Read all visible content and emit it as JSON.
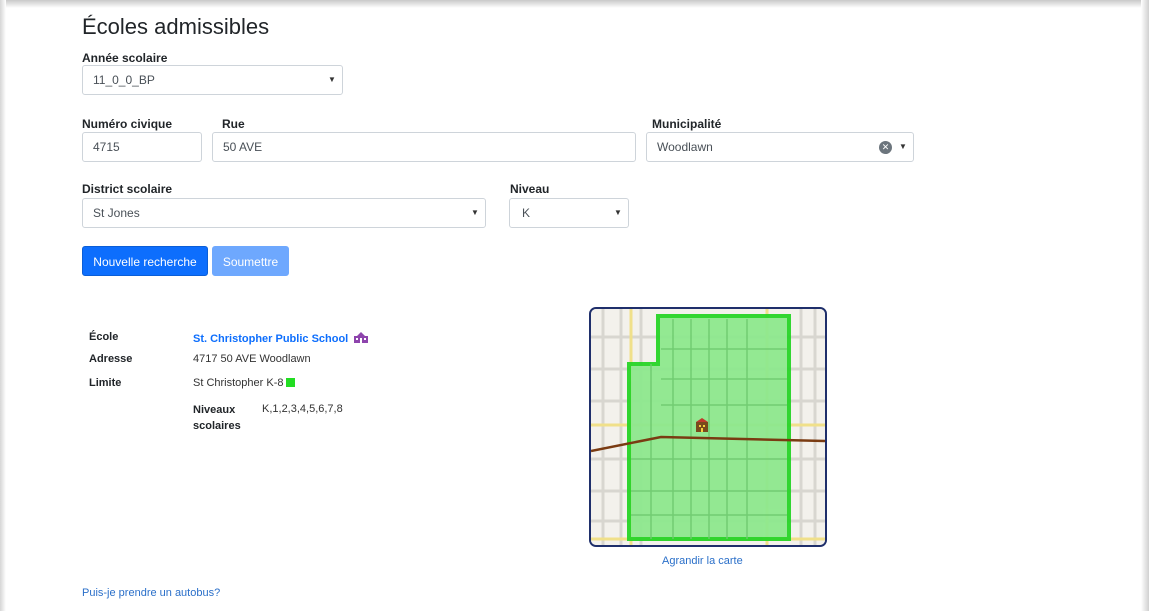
{
  "page": {
    "title": "Écoles admissibles"
  },
  "form": {
    "school_year": {
      "label": "Année scolaire",
      "value": "11_0_0_BP"
    },
    "civic_number": {
      "label": "Numéro civique",
      "value": "4715"
    },
    "street": {
      "label": "Rue",
      "value": "50 AVE"
    },
    "municipality": {
      "label": "Municipalité",
      "value": "Woodlawn"
    },
    "district": {
      "label": "District scolaire",
      "value": "St Jones"
    },
    "level": {
      "label": "Niveau",
      "value": "K"
    }
  },
  "buttons": {
    "new_search": "Nouvelle recherche",
    "submit": "Soumettre"
  },
  "result": {
    "school_label": "École",
    "school_name": "St. Christopher Public School",
    "address_label": "Adresse",
    "address_value": "4717 50 AVE Woodlawn",
    "boundary_label": "Limite",
    "boundary_value": "St Christopher K-8",
    "levels_label_line1": "Niveaux",
    "levels_label_line2": "scolaires",
    "levels_value": "K,1,2,3,4,5,6,7,8"
  },
  "map": {
    "enlarge_link": "Agrandir la carte",
    "boundary_color": "#22dd22"
  },
  "footer": {
    "bus_link": "Puis-je prendre un autobus?"
  },
  "icons": {
    "caret": "▼",
    "clear": "✕",
    "school_building": "school-building-icon",
    "map_marker": "school-marker-icon"
  }
}
